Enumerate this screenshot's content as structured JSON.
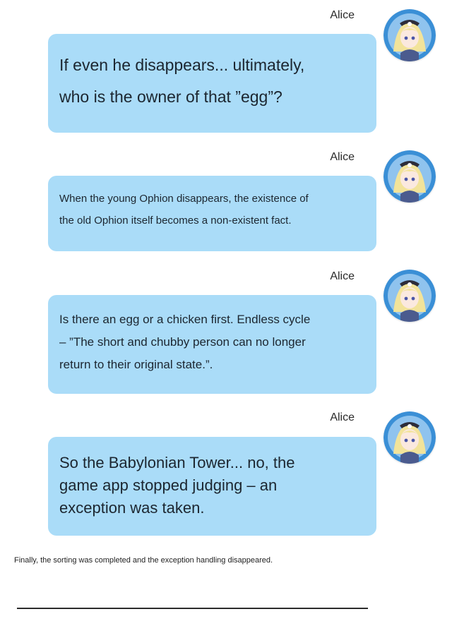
{
  "messages": [
    {
      "sender": "Alice",
      "text": "If even he disappears... ultimately,\nwho is the owner of that ”egg”?"
    },
    {
      "sender": "Alice",
      "text": "When the young Ophion disappears, the existence of\nthe old Ophion itself becomes a non-existent fact."
    },
    {
      "sender": "Alice",
      "text": "Is there an egg or a chicken first. Endless cycle\n– ”The short and chubby person can no longer\nreturn to their original state.”."
    },
    {
      "sender": "Alice",
      "text": "So the Babylonian Tower... no, the\ngame app stopped judging – an\nexception was taken."
    }
  ],
  "caption": "Finally, the sorting was completed and the exception handling disappeared.",
  "colors": {
    "bubble": "#aadcf8",
    "avatar_ring": "#3a8fd6",
    "avatar_hair": "#f2e39a"
  },
  "icons": {
    "avatar": "anime-girl-avatar-icon"
  }
}
